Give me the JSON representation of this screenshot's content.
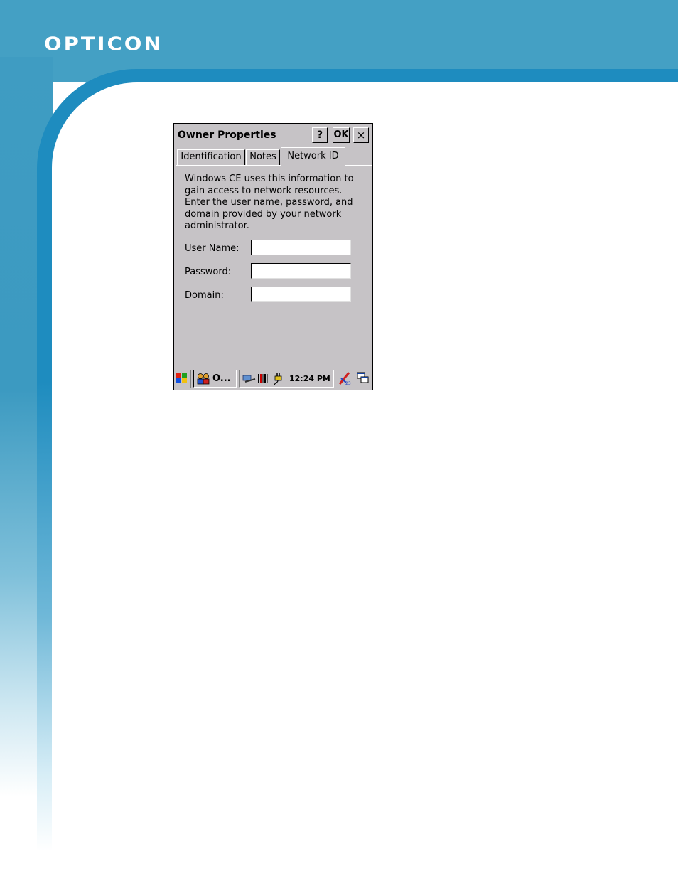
{
  "brand": {
    "logo": "OPTICON"
  },
  "window": {
    "title": "Owner Properties",
    "help_label": "?",
    "ok_label": "OK",
    "close_label": "×"
  },
  "tabs": [
    {
      "label": "Identification",
      "active": false
    },
    {
      "label": "Notes",
      "active": false
    },
    {
      "label": "Network ID",
      "active": true
    }
  ],
  "network_id": {
    "intro": "Windows CE uses this information to gain access to network resources. Enter the user name, password, and domain provided by your network administrator.",
    "fields": [
      {
        "label": "User Name:",
        "value": ""
      },
      {
        "label": "Password:",
        "value": ""
      },
      {
        "label": "Domain:",
        "value": ""
      }
    ]
  },
  "taskbar": {
    "app_label": "O...",
    "clock": "12:24 PM",
    "icons": [
      "start-icon",
      "owner-app-icon",
      "network-icon",
      "barcode-icon",
      "power-icon",
      "input-panel-icon",
      "desktop-icon"
    ]
  },
  "colors": {
    "band_blue": "#44a0c4",
    "curve_blue": "#1e8cbf",
    "window_gray": "#c6c3c6"
  }
}
